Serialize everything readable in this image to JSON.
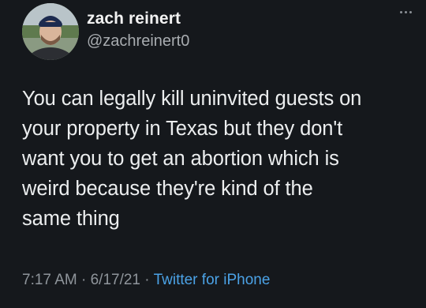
{
  "author": {
    "display_name": "zach reinert",
    "handle": "@zachreinert0"
  },
  "tweet": {
    "lines": [
      "You can legally kill uninvited guests on",
      "your property in Texas but they don't",
      "want you to get an abortion which is",
      "weird because they're kind of the",
      "same thing"
    ]
  },
  "meta": {
    "time": "7:17 AM",
    "separator": " · ",
    "date": "6/17/21",
    "source": "Twitter for iPhone"
  },
  "icons": {
    "more": "more-options-icon",
    "avatar": "avatar"
  }
}
